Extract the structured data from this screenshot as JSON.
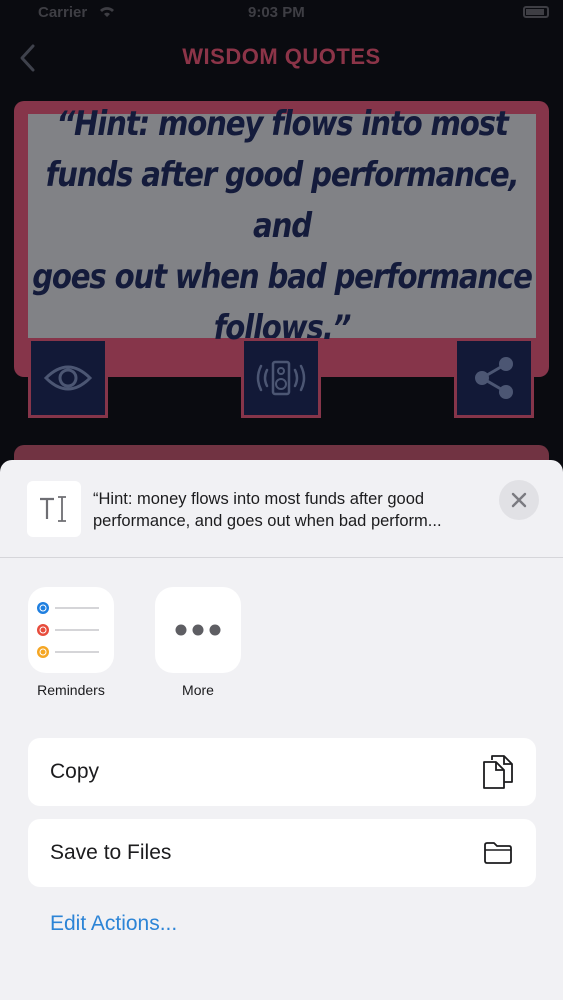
{
  "status_bar": {
    "carrier": "Carrier",
    "time": "9:03 PM"
  },
  "nav": {
    "title": "WISDOM QUOTES"
  },
  "quote": {
    "line1": "“Hint: money flows into most",
    "line2": "funds after good performance, and",
    "line3": "goes out when bad performance",
    "line4": "follows.”"
  },
  "share_sheet": {
    "preview_line1": "“Hint: money flows into most funds after good",
    "preview_line2": "performance, and goes out when bad perform...",
    "apps": [
      {
        "label": "Reminders"
      },
      {
        "label": "More"
      }
    ],
    "actions": [
      {
        "label": "Copy"
      },
      {
        "label": "Save to Files"
      }
    ],
    "edit_actions_label": "Edit Actions..."
  },
  "colors": {
    "accent": "#c14c6a",
    "card_button_bg": "#1a2550",
    "link": "#2c84d6"
  }
}
